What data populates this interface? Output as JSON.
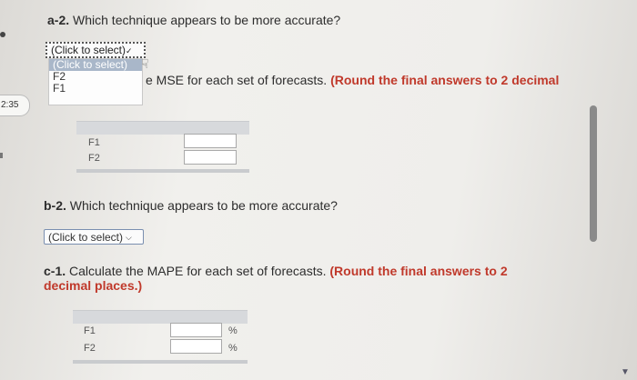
{
  "sidebar": {
    "timer": "2:35"
  },
  "part_a2": {
    "question_label": "a-2.",
    "question_text": "Which technique appears to be more accurate?",
    "select_value": "(Click to select)",
    "options": [
      "(Click to select)",
      "F2",
      "F1"
    ]
  },
  "part_b1": {
    "visible_text": "e MSE for each set of forecasts.",
    "instruction": "(Round the final answers to 2 decimal"
  },
  "mse_table": {
    "rows": [
      "F1",
      "F2"
    ]
  },
  "part_b2": {
    "question_label": "b-2.",
    "question_text": "Which technique appears to be more accurate?",
    "select_value": "(Click to select)"
  },
  "part_c1": {
    "question_label": "c-1.",
    "question_text": "Calculate the MAPE for each set of forecasts.",
    "instruction_line1": "(Round the final answers to 2",
    "instruction_line2": "decimal places.)"
  },
  "mape_table": {
    "rows": [
      "F1",
      "F2"
    ],
    "unit": "%"
  }
}
